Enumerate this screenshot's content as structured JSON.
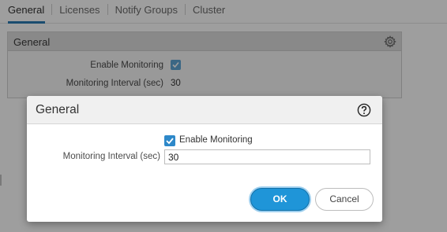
{
  "tabs": [
    {
      "label": "General",
      "active": true
    },
    {
      "label": "Licenses",
      "active": false
    },
    {
      "label": "Notify Groups",
      "active": false
    },
    {
      "label": "Cluster",
      "active": false
    }
  ],
  "background_panel": {
    "title": "General",
    "icon": "gear-icon",
    "rows": [
      {
        "label": "Enable Monitoring",
        "checked": true
      },
      {
        "label": "Monitoring Interval (sec)",
        "value": "30"
      }
    ]
  },
  "dialog": {
    "title": "General",
    "help_icon": "help-icon",
    "enable_monitoring": {
      "label": "Enable Monitoring",
      "checked": true
    },
    "interval": {
      "label": "Monitoring Interval (sec)",
      "value": "30"
    },
    "ok_label": "OK",
    "cancel_label": "Cancel"
  },
  "colors": {
    "accent": "#1f95d8",
    "active_tab_underline": "#2a7bb4",
    "checkbox": "#2d88c9"
  }
}
